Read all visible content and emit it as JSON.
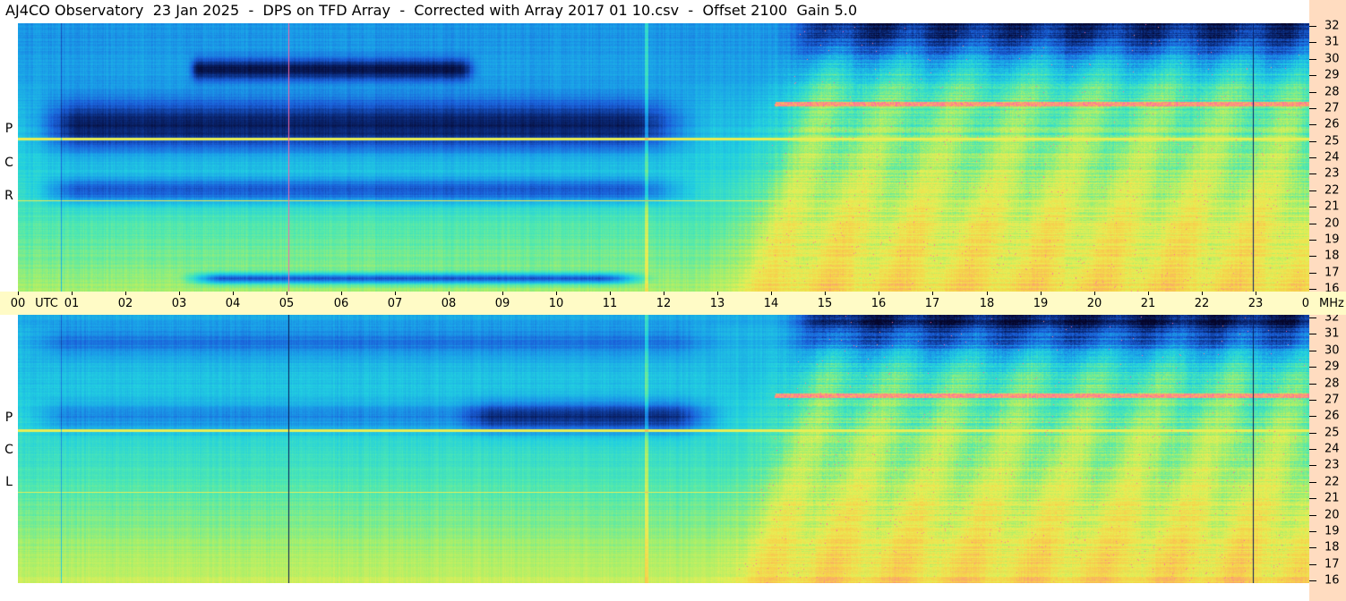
{
  "header": {
    "title": "AJ4CO Observatory  23 Jan 2025  -  DPS on TFD Array  -  Corrected with Array 2017 01 10.csv  -  Offset 2100  Gain 5.0"
  },
  "panels": {
    "top": {
      "letters": [
        "R",
        "C",
        "P"
      ]
    },
    "bottom": {
      "letters": [
        "L",
        "C",
        "P"
      ]
    }
  },
  "time_axis": {
    "ticks": [
      "00",
      "01",
      "02",
      "03",
      "04",
      "05",
      "06",
      "07",
      "08",
      "09",
      "10",
      "11",
      "12",
      "13",
      "14",
      "15",
      "16",
      "17",
      "18",
      "19",
      "20",
      "21",
      "22",
      "23",
      "00"
    ],
    "unit_label": "UTC",
    "freq_unit_label": "MHz"
  },
  "freq_axis": {
    "ticks": [
      "32",
      "31",
      "30",
      "29",
      "28",
      "27",
      "26",
      "25",
      "24",
      "23",
      "22",
      "21",
      "20",
      "19",
      "18",
      "17",
      "16"
    ]
  },
  "colors": {
    "background": "#ffffff",
    "time_axis_bg": "#fffbc6",
    "freq_axis_bg": "#ffdcc0"
  },
  "chart_data": {
    "type": "heatmap",
    "title": "AJ4CO Observatory  23 Jan 2025  -  DPS on TFD Array  -  Corrected with Array 2017 01 10.csv  -  Offset 2100  Gain 5.0",
    "x_range": [
      "00",
      "00"
    ],
    "x_unit": "UTC",
    "y_range": [
      16,
      32
    ],
    "y_unit": "MHz",
    "panels": [
      "RCP",
      "LCP"
    ],
    "colormap": [
      "#05052a",
      "#0a2a7a",
      "#1a5fd9",
      "#1a9fe8",
      "#22d0e0",
      "#4fe8b0",
      "#a8ef6a",
      "#e8ee55",
      "#f7d24a",
      "#fba66a",
      "#ff5ab8",
      "#ffffff"
    ]
  }
}
